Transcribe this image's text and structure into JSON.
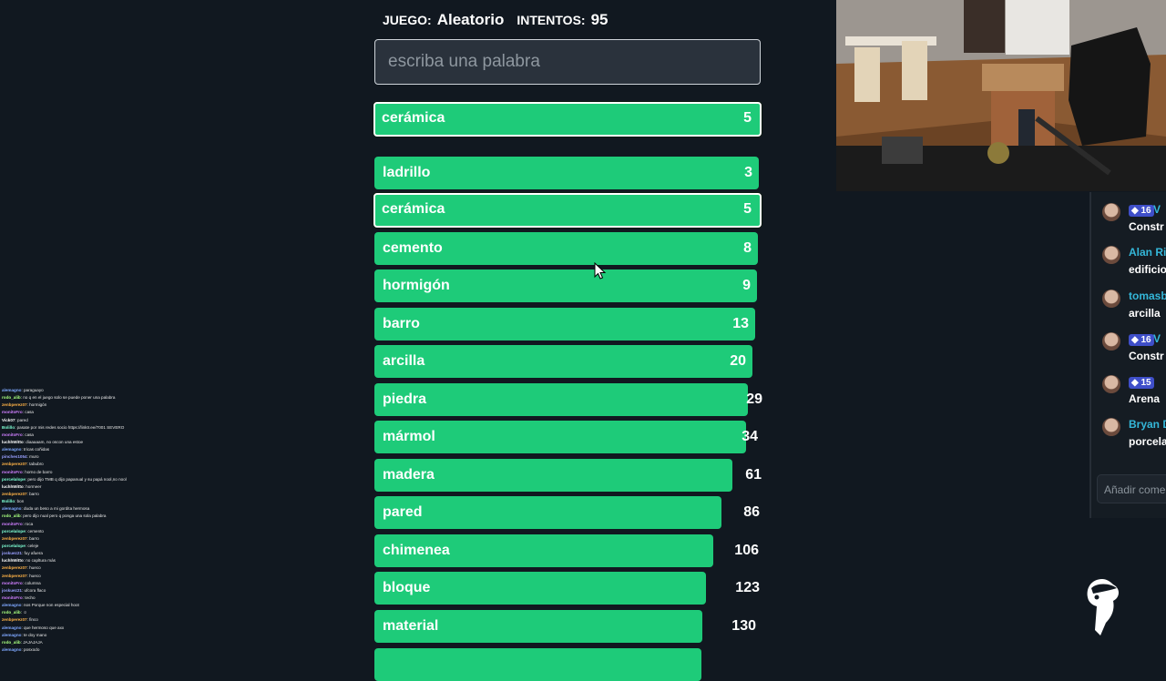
{
  "game": {
    "game_label": "JUEGO:",
    "game_value": "Aleatorio",
    "attempts_label": "INTENTOS:",
    "attempts_value": "95"
  },
  "input": {
    "placeholder": "escriba una palabra"
  },
  "current_guess": {
    "word": "cerámica",
    "rank": "5"
  },
  "guesses": [
    {
      "word": "ladrillo",
      "rank": "3"
    },
    {
      "word": "cerámica",
      "rank": "5"
    },
    {
      "word": "cemento",
      "rank": "8"
    },
    {
      "word": "hormigón",
      "rank": "9"
    },
    {
      "word": "barro",
      "rank": "13"
    },
    {
      "word": "arcilla",
      "rank": "20"
    },
    {
      "word": "piedra",
      "rank": "29"
    },
    {
      "word": "mármol",
      "rank": "34"
    },
    {
      "word": "madera",
      "rank": "61"
    },
    {
      "word": "pared",
      "rank": "86"
    },
    {
      "word": "chimenea",
      "rank": "106"
    },
    {
      "word": "bloque",
      "rank": "123"
    },
    {
      "word": "material",
      "rank": "130"
    }
  ],
  "chat": {
    "messages": [
      {
        "badge": "16",
        "name": "V",
        "text": "Constr"
      },
      {
        "name": "Alan Ri",
        "text": "edificio"
      },
      {
        "name": "tomasb",
        "text": "arcilla"
      },
      {
        "badge": "16",
        "name": "V",
        "text": "Constr"
      },
      {
        "badge": "15",
        "name": "",
        "text": "Arena"
      },
      {
        "name": "Bryan D",
        "text": "porcela"
      }
    ],
    "input_placeholder": "Añadir come"
  },
  "mini_chat": [
    {
      "name": "alemagno",
      "color": "#7fa8ff",
      "text": ": paraguayo"
    },
    {
      "name": "rodo_alib",
      "color": "#a8ff7f",
      "text": ": no q en el juego solo se puede poner una palabra"
    },
    {
      "name": "zenbperez07",
      "color": "#ffb347",
      "text": ": hormigón"
    },
    {
      "name": "monitoFro",
      "color": "#d07fff",
      "text": ": casa"
    },
    {
      "name": "Vick07",
      "color": "#ffffff",
      "text": ": pared"
    },
    {
      "name": "Bolillo",
      "color": "#7fffd4",
      "text": ": pasate por mis redes socio https://linktr.ee/7001 SEVERO"
    },
    {
      "name": "monitoFro",
      "color": "#d07fff",
      "text": ": casa"
    },
    {
      "name": "luchhWitto",
      "color": "#ffffff",
      "text": ": diaaaaam, no oscon una estoe"
    },
    {
      "name": "alemagno",
      "color": "#7fa8ff",
      "text": ": tricas coñidas"
    },
    {
      "name": "pinches1054",
      "color": "#9aa0ff",
      "text": ": muro"
    },
    {
      "name": "zenbperez07",
      "color": "#ffb347",
      "text": ": tabubro"
    },
    {
      "name": "monitoFro",
      "color": "#d07fff",
      "text": ": horno de barro"
    },
    {
      "name": "porcelalope",
      "color": "#7fffd4",
      "text": ": pero dijo TMB q dijo papanual y su papá nool,no nool"
    },
    {
      "name": "luchhWitto",
      "color": "#ffffff",
      "text": ": hormeer"
    },
    {
      "name": "zenbperez07",
      "color": "#ffb347",
      "text": ": barro"
    },
    {
      "name": "Bolillo",
      "color": "#7fffd4",
      "text": ": bon"
    },
    {
      "name": "alemagno",
      "color": "#7fa8ff",
      "text": ": duda un beso a mi gordita hermosa"
    },
    {
      "name": "rodo_alib",
      "color": "#a8ff7f",
      "text": ": pero dijo nual pero q ponga una sola palabra"
    },
    {
      "name": "monitoFro",
      "color": "#d07fff",
      "text": ": roca"
    },
    {
      "name": "porcelalope",
      "color": "#7fffd4",
      "text": ": cemento"
    },
    {
      "name": "zenbperez07",
      "color": "#ffb347",
      "text": ": barro"
    },
    {
      "name": "porcelalope",
      "color": "#7fffd4",
      "text": ": celeje"
    },
    {
      "name": "joskuez21",
      "color": "#9aa0ff",
      "text": ": fuy afuera"
    },
    {
      "name": "luchhWitto",
      "color": "#ffffff",
      "text": ": no capltura más"
    },
    {
      "name": "zenbperez07",
      "color": "#ffb347",
      "text": ": hueco"
    },
    {
      "name": "zenbperez07",
      "color": "#ffb347",
      "text": ": hueco"
    },
    {
      "name": "monitoFro",
      "color": "#d07fff",
      "text": ": columna"
    },
    {
      "name": "joskuez21",
      "color": "#9aa0ff",
      "text": ": ufcora flaco"
    },
    {
      "name": "monitoFro",
      "color": "#d07fff",
      "text": ": techo"
    },
    {
      "name": "alemagno",
      "color": "#7fa8ff",
      "text": ": nos Porque non especial hoot"
    },
    {
      "name": "rodo_alib",
      "color": "#a8ff7f",
      "text": ": ☺"
    },
    {
      "name": "zenbperez07",
      "color": "#ffb347",
      "text": ": finco"
    },
    {
      "name": "alemagno",
      "color": "#7fa8ff",
      "text": ": que hermoso que axx"
    },
    {
      "name": "alemagno",
      "color": "#7fa8ff",
      "text": ": te doy mano"
    },
    {
      "name": "rodo_alib",
      "color": "#a8ff7f",
      "text": ": JAJAJAJA"
    },
    {
      "name": "alemagno",
      "color": "#7fa8ff",
      "text": ": posxodo"
    }
  ],
  "colors": {
    "background": "#111820",
    "bar": "#1ecb79",
    "highlight_border": "#ffffff",
    "badge": "#3f4fc9"
  },
  "icons": {
    "cursor": "pointer-cursor-icon",
    "logo": "toucan-logo-icon"
  }
}
